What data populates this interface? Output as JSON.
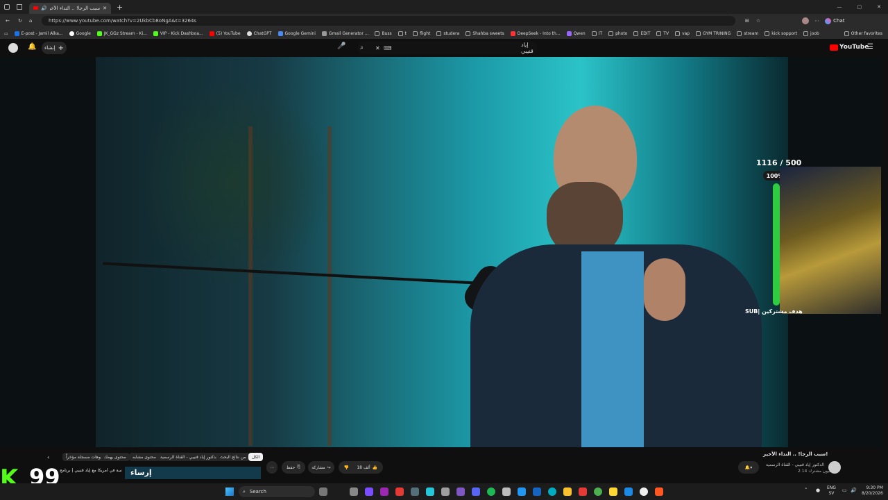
{
  "browser": {
    "tab_title": "سنبا الرحاة .. النداء الأخير! - YouTube",
    "tab_short": "سبب الرجا! .. النداء الأخيرا",
    "url": "https://www.youtube.com/watch?v=2UkbCb8oNgA&t=3264s",
    "bookmarks": [
      "E-post - Jamil Alka...",
      "Google",
      "JK_GGz Stream - Ki...",
      "VIP - Kick Dashboa...",
      "(5) YouTube",
      "ChatGPT",
      "Google Gemini",
      "Gmail Generator ...",
      "Buss",
      "t",
      "flight",
      "studera",
      "Shahba sweets",
      "DeepSeek - Into th...",
      "Qwen",
      "IT",
      "photo",
      "EDIT",
      "TV",
      "vap",
      "GYM TRINING",
      "stream",
      "kick sopport",
      "joob"
    ],
    "other_favorites": "Other favorites",
    "chat_label": "Chat"
  },
  "youtube": {
    "logo_text": "YouTube",
    "create_label": "إنشاء",
    "search_query": "إياد قنيبي"
  },
  "overlay": {
    "sub_count": "1116 / 500",
    "percent": "100%",
    "sub_label": "SUB| هدف مشتركين",
    "kick_number": "99"
  },
  "video_info": {
    "title": "سبب الرجا! .. النداء الأخير!",
    "channel": "الدكتور إياد قنيبي - القناة الرسمية",
    "subscribers": "2.14 مليون مشترك",
    "likes": "18 ألف",
    "share_label": "مشاركة",
    "save_label": "حفظ",
    "chips": [
      "الكل",
      "من نتائج البحث",
      "من الدكتور إياد قنيبي - القناة الرسمية",
      "محتوى مشابه",
      "محتوى يهمك",
      "فيديوهات مسجلة مؤخراً"
    ],
    "rec_title": "تجربة الدراسة في أمريكا مع إياد قنيبي | برنامج",
    "rec_thumb_text": "إرساء"
  },
  "taskbar": {
    "search_label": "Search",
    "lang_top": "ENG",
    "lang_bottom": "SV",
    "time": "9:30 PM",
    "date": "8/20/2026"
  }
}
